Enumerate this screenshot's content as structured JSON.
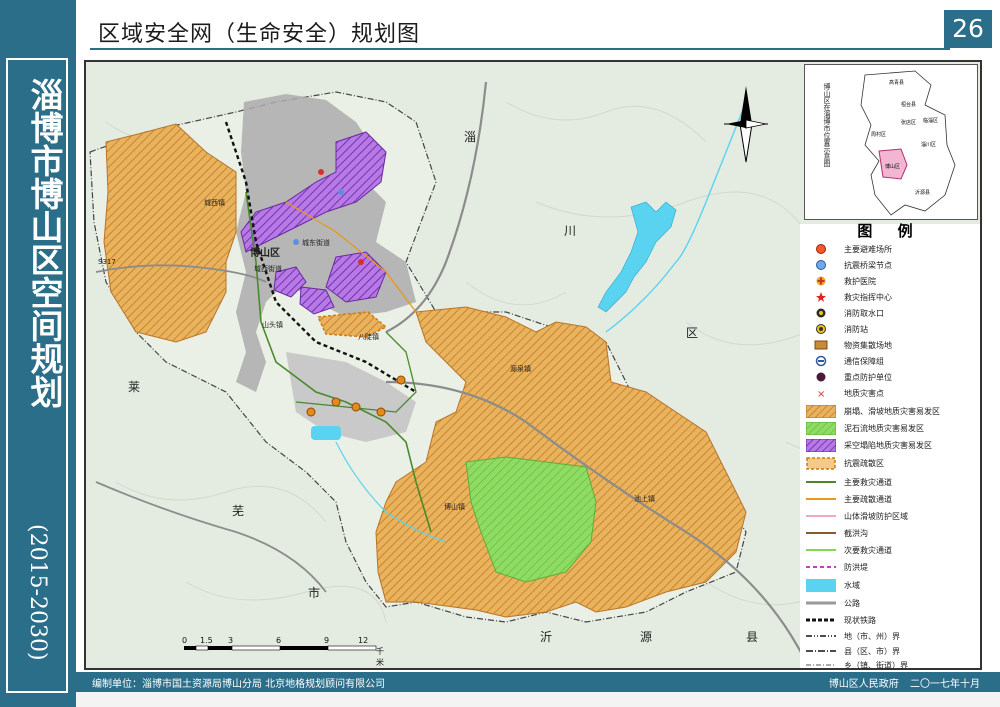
{
  "header": {
    "map_title": "区域安全网（生命安全）规划图",
    "page_number": "26"
  },
  "side_title": {
    "main": "淄博市博山区空间规划",
    "years": "(2015-2030)"
  },
  "map": {
    "region_labels": [
      "淄",
      "川",
      "区",
      "莱",
      "芜",
      "市",
      "沂",
      "源",
      "县"
    ],
    "town_labels": [
      "城西镇",
      "博山区",
      "城东街道",
      "域西街道",
      "山头镇",
      "八陡镇",
      "源泉镇",
      "博山镇",
      "池上镇",
      "S317"
    ],
    "colors": {
      "landslide_hatch": "#e2a34a",
      "debris_flow_hatch": "#8fd860",
      "subsidence_hatch": "#9a4ad0",
      "water": "#59d3f0",
      "urban": "#a9a9a9",
      "terrain": "#e7ece4"
    }
  },
  "inset": {
    "label": "博山区在淄博市位置示意图",
    "place_names": [
      "高青县",
      "桓台县",
      "临淄区",
      "张店区",
      "淄川区",
      "博山区",
      "沂源县",
      "周村区"
    ]
  },
  "legend": {
    "title": "图 例",
    "items": [
      {
        "label": "主要避难场所",
        "icon": "shelter-icon"
      },
      {
        "label": "抗震桥梁节点",
        "icon": "bridge-icon"
      },
      {
        "label": "救护医院",
        "icon": "hospital-icon"
      },
      {
        "label": "救灾指挥中心",
        "icon": "command-icon"
      },
      {
        "label": "消防取水口",
        "icon": "water-intake-icon"
      },
      {
        "label": "消防站",
        "icon": "fire-station-icon"
      },
      {
        "label": "物资集散场地",
        "icon": "depot-icon"
      },
      {
        "label": "通信保障组",
        "icon": "communication-icon"
      },
      {
        "label": "重点防护单位",
        "icon": "key-unit-icon"
      },
      {
        "label": "地质灾害点",
        "icon": "geohazard-icon"
      },
      {
        "label": "崩塌、滑坡地质灾害易发区",
        "icon": "landslide-zone-icon"
      },
      {
        "label": "泥石流地质灾害易发区",
        "icon": "debris-flow-zone-icon"
      },
      {
        "label": "采空塌陷地质灾害易发区",
        "icon": "subsidence-zone-icon"
      },
      {
        "label": "抗震疏散区",
        "icon": "evacuation-zone-icon"
      },
      {
        "label": "主要救灾通道",
        "icon": "main-rescue-road-icon"
      },
      {
        "label": "主要疏散通道",
        "icon": "main-evacuation-road-icon"
      },
      {
        "label": "山体滑坡防护区域",
        "icon": "slope-protection-icon"
      },
      {
        "label": "截洪沟",
        "icon": "flood-ditch-icon"
      },
      {
        "label": "次要救灾通道",
        "icon": "secondary-rescue-road-icon"
      },
      {
        "label": "防洪堤",
        "icon": "levee-icon"
      },
      {
        "label": "水域",
        "icon": "water-icon"
      },
      {
        "label": "公路",
        "icon": "highway-icon"
      },
      {
        "label": "现状铁路",
        "icon": "railway-icon"
      },
      {
        "label": "地（市、州）界",
        "icon": "city-boundary-icon"
      },
      {
        "label": "县（区、市）界",
        "icon": "county-boundary-icon"
      },
      {
        "label": "乡（镇、街道）界",
        "icon": "town-boundary-icon"
      }
    ]
  },
  "scale_bar": {
    "ticks": [
      "0",
      "1.5",
      "3",
      "6",
      "9",
      "12"
    ],
    "unit": "千米"
  },
  "footer": {
    "left": "编制单位：淄博市国土资源局博山分局    北京地格规划顾问有限公司",
    "right": "博山区人民政府    二〇一七年十月"
  }
}
